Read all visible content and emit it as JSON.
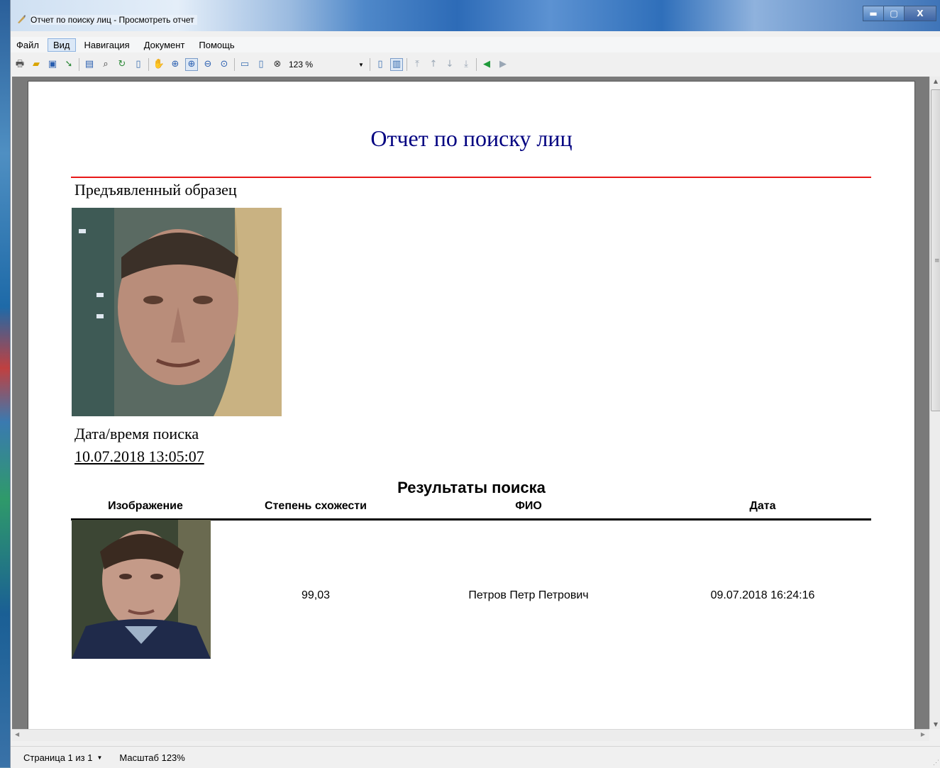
{
  "window": {
    "title": "Отчет по поиску лиц - Просмотреть отчет",
    "buttons": {
      "minimize": "▬",
      "maximize": "▢",
      "close": "X"
    }
  },
  "menu": [
    "Файл",
    "Вид",
    "Навигация",
    "Документ",
    "Помощь"
  ],
  "toolbar": {
    "zoom_value": "123 %",
    "icons": [
      "print-icon",
      "open-icon",
      "save-icon",
      "export-icon",
      "outline-icon",
      "find-icon",
      "refresh-icon",
      "page-setup-icon",
      "hand-icon",
      "zoom-in-icon",
      "zoom-rect-icon",
      "zoom-out-icon",
      "zoom-select-icon",
      "page-width-icon",
      "whole-page-icon",
      "actual-size-icon",
      "single-page-icon",
      "multi-page-icon",
      "first-page-icon",
      "prev-page-icon",
      "next-page-icon",
      "last-page-icon",
      "back-icon",
      "forward-icon"
    ]
  },
  "report": {
    "title": "Отчет по поиску лиц",
    "sample_label": "Предъявленный образец",
    "search_datetime_label": "Дата/время поиска",
    "search_datetime_value": "10.07.2018 13:05:07",
    "results_title": "Результаты поиска",
    "columns": [
      "Изображение",
      "Степень схожести",
      "ФИО",
      "Дата"
    ],
    "rows": [
      {
        "similarity": "99,03",
        "name": "Петров Петр Петрович",
        "date": "09.07.2018 16:24:16"
      }
    ],
    "colors": {
      "title": "#000080",
      "title_rule": "#e81818"
    }
  },
  "statusbar": {
    "page": "Страница 1 из 1",
    "zoom": "Масштаб 123%"
  }
}
